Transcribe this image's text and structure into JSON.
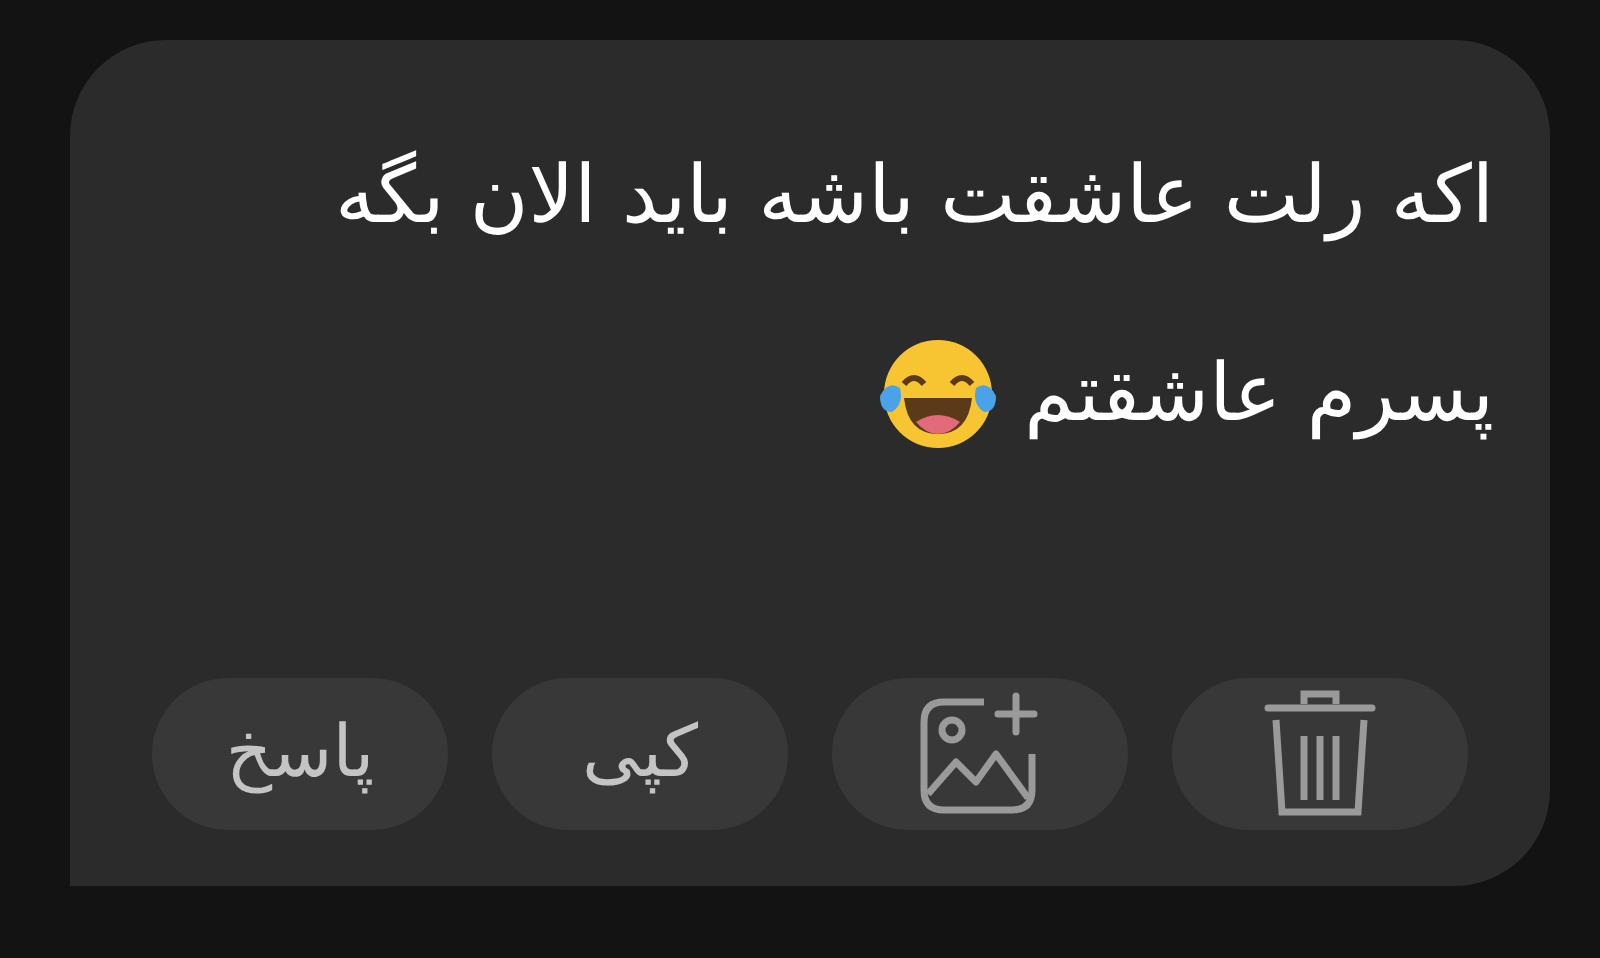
{
  "message": {
    "lines": [
      "اکه رلت عاشقت باشه باید الان بگه",
      "پسرم عاشقتم"
    ]
  },
  "actions": [
    {
      "kind": "trash"
    },
    {
      "kind": "image"
    },
    {
      "kind": "text",
      "label": "کپی"
    },
    {
      "kind": "text",
      "label": "پاسخ"
    }
  ]
}
